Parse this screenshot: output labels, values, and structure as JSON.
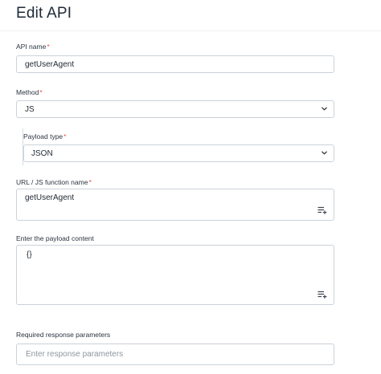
{
  "header": {
    "title": "Edit API"
  },
  "form": {
    "api_name": {
      "label": "API name",
      "required_mark": "*",
      "value": "getUserAgent"
    },
    "method": {
      "label": "Method",
      "required_mark": "*",
      "value": "JS"
    },
    "payload_type": {
      "label": "Payload type",
      "required_mark": "*",
      "value": "JSON"
    },
    "url_fn": {
      "label": "URL / JS function name",
      "required_mark": "*",
      "value": "getUserAgent"
    },
    "payload_content": {
      "label": "Enter the payload content",
      "value": "{}"
    },
    "response_params": {
      "label": "Required response parameters",
      "placeholder": "Enter response parameters"
    }
  },
  "icons": {
    "dropdown": "chevron-down-icon",
    "expand": "playlist-add-icon"
  },
  "colors": {
    "required": "#e8504a",
    "border": "#cbd2da",
    "text": "#1f2933"
  }
}
